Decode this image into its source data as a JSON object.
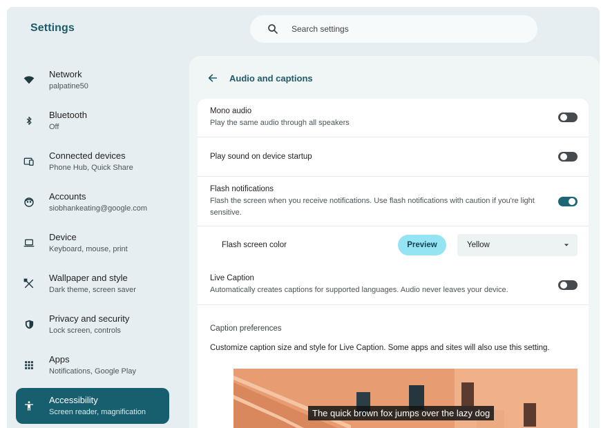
{
  "app": {
    "title": "Settings"
  },
  "search": {
    "placeholder": "Search settings",
    "value": ""
  },
  "sidebar": {
    "items": [
      {
        "label": "Network",
        "sub": "palpatine50",
        "icon": "wifi-icon",
        "active": false
      },
      {
        "label": "Bluetooth",
        "sub": "Off",
        "icon": "bluetooth-icon",
        "active": false
      },
      {
        "label": "Connected devices",
        "sub": "Phone Hub, Quick Share",
        "icon": "connected-devices-icon",
        "active": false
      },
      {
        "label": "Accounts",
        "sub": "siobhankeating@google.com",
        "icon": "account-face-icon",
        "active": false
      },
      {
        "label": "Device",
        "sub": "Keyboard, mouse, print",
        "icon": "laptop-icon",
        "active": false
      },
      {
        "label": "Wallpaper and style",
        "sub": "Dark theme, screen saver",
        "icon": "paint-tools-icon",
        "active": false
      },
      {
        "label": "Privacy and security",
        "sub": "Lock screen, controls",
        "icon": "shield-icon",
        "active": false
      },
      {
        "label": "Apps",
        "sub": "Notifications, Google Play",
        "icon": "apps-grid-icon",
        "active": false
      },
      {
        "label": "Accessibility",
        "sub": "Screen reader, magnification",
        "icon": "accessibility-icon",
        "active": true
      }
    ]
  },
  "page": {
    "title": "Audio and captions"
  },
  "settings": {
    "mono_audio": {
      "label": "Mono audio",
      "sub": "Play the same audio through all speakers",
      "on": false
    },
    "startup_sound": {
      "label": "Play sound on device startup",
      "on": false
    },
    "flash": {
      "label": "Flash notifications",
      "sub": "Flash the screen when you receive notifications. Use flash notifications with caution if you're light sensitive.",
      "on": true
    },
    "flash_color": {
      "label": "Flash screen color",
      "preview_label": "Preview",
      "selected": "Yellow"
    },
    "live_caption": {
      "label": "Live Caption",
      "sub": "Automatically creates captions for supported languages. Audio never leaves your device.",
      "on": false
    },
    "caption_prefs": {
      "heading": "Caption preferences",
      "desc": "Customize caption size and style for Live Caption. Some apps and sites will also use this setting.",
      "sample_text": "The quick brown fox jumps over the lazy dog"
    }
  },
  "colors": {
    "accent": "#175f6e",
    "preview_button": "#95e4f4",
    "toggle_on": "#1d6675",
    "toggle_off": "#444a4d"
  }
}
